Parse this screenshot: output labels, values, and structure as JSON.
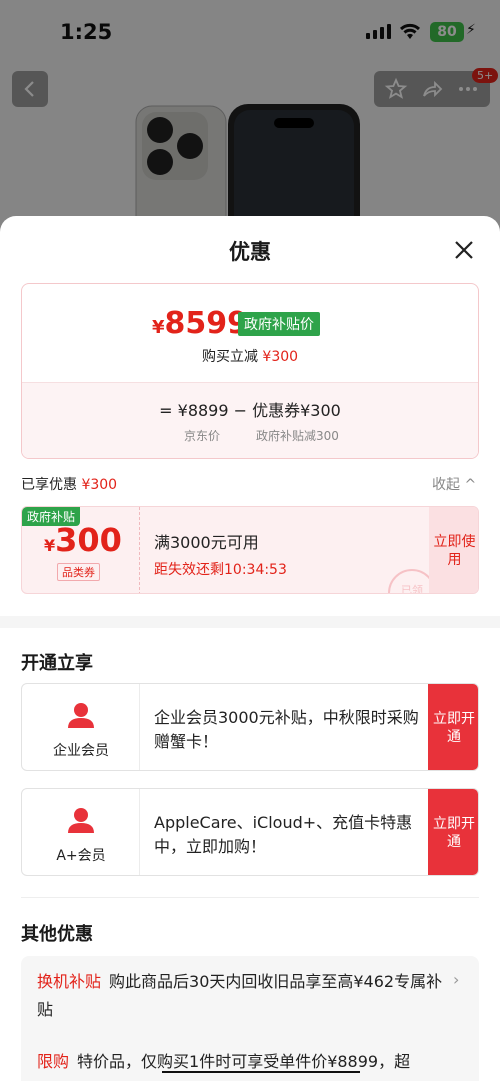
{
  "status_bar": {
    "time": "1:25",
    "battery": "80"
  },
  "header": {
    "notification_badge": "5+"
  },
  "sheet": {
    "title": "优惠",
    "price": {
      "currency": "¥",
      "amount": "8599",
      "tag": "政府补贴价"
    },
    "reduce_line": {
      "prefix": "购买立减",
      "amount": "¥300"
    },
    "equation": {
      "text": "=  ¥8899  −  优惠券¥300",
      "left_caption": "京东价",
      "right_caption": "政府补贴减300"
    },
    "enjoyed": {
      "label": "已享优惠",
      "amount": "¥300",
      "collapse": "收起 ^"
    },
    "coupon": {
      "tag": "政府补贴",
      "currency": "¥",
      "amount": "300",
      "kind": "品类券",
      "condition": "满3000元可用",
      "expire": "距失效还剩10:34:53",
      "use_button": "立即使用",
      "stamp": "已领"
    },
    "open_section": {
      "title": "开通立享",
      "items": [
        {
          "name": "企业会员",
          "desc": "企业会员3000元补贴，中秋限时采购赠蟹卡！",
          "button": "立即开通"
        },
        {
          "name": "A+会员",
          "desc": "AppleCare、iCloud+、充值卡特惠中，立即加购！",
          "button": "立即开通"
        }
      ]
    },
    "other_section": {
      "title": "其他优惠",
      "rows": [
        {
          "label": "换机补贴",
          "text": "购此商品后30天内回收旧品享至高¥462专属补贴"
        },
        {
          "label": "限购",
          "text": "特价品，仅购买1件时可享受单件价¥8899，超"
        }
      ]
    }
  },
  "colors": {
    "accent": "#e2231a",
    "gov_green": "#2ea34a",
    "button_red": "#e8323a"
  }
}
